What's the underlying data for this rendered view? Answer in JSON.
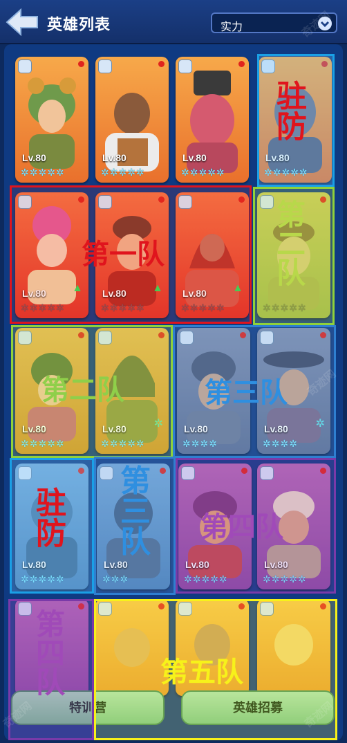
{
  "header": {
    "title": "英雄列表",
    "sort_label": "实力"
  },
  "heroes": [
    {
      "level": "Lv.80"
    },
    {
      "level": "Lv.80"
    },
    {
      "level": "Lv.80"
    },
    {
      "level": "Lv.80"
    },
    {
      "level": "Lv.80"
    },
    {
      "level": "Lv.80"
    },
    {
      "level": "Lv.80"
    },
    {
      "level": ""
    },
    {
      "level": "Lv.80"
    },
    {
      "level": "Lv.80"
    },
    {
      "level": "Lv.80"
    },
    {
      "level": "Lv.80"
    },
    {
      "level": "Lv.80"
    },
    {
      "level": "Lv.80"
    },
    {
      "level": "Lv.80"
    },
    {
      "level": "Lv.80"
    }
  ],
  "stars": {
    "five": "✲✲✲✲✲",
    "four": "✲✲✲✲",
    "three": "✲✲✲"
  },
  "annotations": {
    "garrison": "驻防",
    "team1": "第一队",
    "team2": "第二队",
    "team3": "第三队",
    "team4": "第四队",
    "team5": "第五队"
  },
  "bottom": {
    "training_label": "特训营",
    "recruit_label": "英雄招募"
  },
  "watermark": "奇迹网"
}
